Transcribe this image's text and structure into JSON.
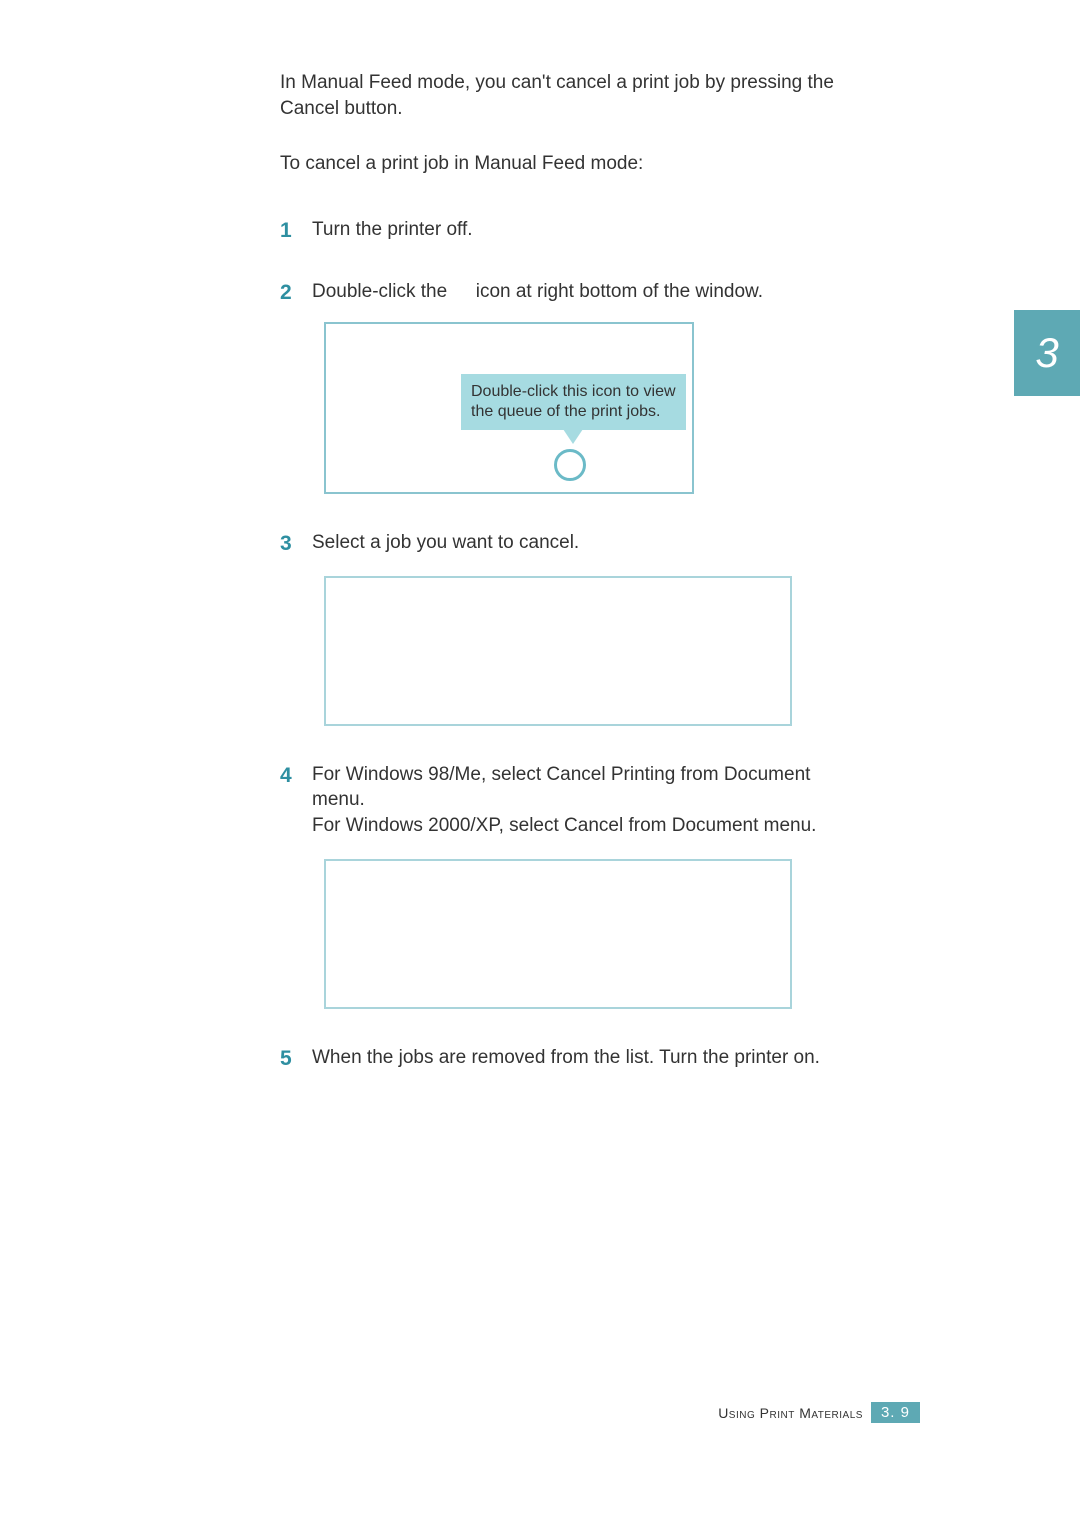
{
  "chapter_tab": "3",
  "intro": {
    "pre": "In Manual Feed mode, you can't cancel a print job by pressing the ",
    "cancel_label": "Cancel",
    "post": " button."
  },
  "lead_in": "To cancel a print job in Manual Feed mode:",
  "steps": {
    "s1": {
      "text": "Turn the printer off."
    },
    "s2": {
      "pre": "Double-click the ",
      "post": " icon at right bottom of the window.",
      "callout_text": "Double-click this icon to view the queue of the print jobs."
    },
    "s3": {
      "text": "Select a job you want to cancel."
    },
    "s4": {
      "line1_pre": "For Windows 98/Me, select ",
      "line1_label": "Cancel Printing",
      "line1_mid": " from ",
      "line1_doc": "Document",
      "line1_post": " menu.",
      "line2_pre": "For Windows 2000/XP, select ",
      "line2_label": "Cancel",
      "line2_mid": " from ",
      "line2_doc": "Document",
      "line2_post": " menu."
    },
    "s5": {
      "text": "When the jobs are removed from the list. Turn the printer on."
    }
  },
  "footer": {
    "section": "Using Print Materials",
    "page": "3. 9"
  }
}
